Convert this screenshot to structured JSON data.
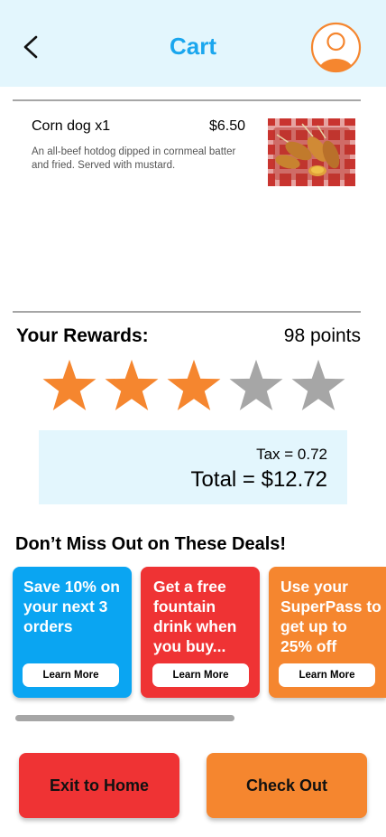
{
  "header": {
    "title": "Cart",
    "back_icon": "chevron-left-icon",
    "avatar_icon": "user-avatar-icon",
    "accent_color": "#1aa6ee",
    "avatar_color": "#f5862f"
  },
  "cart": {
    "items": [
      {
        "name": "Corn dog x1",
        "price": "$6.50",
        "description": "An all-beef hotdog dipped in cornmeal batter and fried. Served with mustard.",
        "image": "corn-dog-photo"
      }
    ]
  },
  "rewards": {
    "label": "Your Rewards:",
    "points": "98 points",
    "stars_filled": 3,
    "stars_total": 5,
    "star_color_filled": "#f5862f",
    "star_color_empty": "#a6a6a6"
  },
  "totals": {
    "tax": "Tax = 0.72",
    "total": "Total = $12.72"
  },
  "deals": {
    "title": "Don’t Miss Out on These Deals!",
    "cards": [
      {
        "text": "Save 10% on your next 3 orders",
        "button": "Learn More",
        "color": "#0aa5f2"
      },
      {
        "text": "Get a free fountain drink when you buy...",
        "button": "Learn More",
        "color": "#ef3334"
      },
      {
        "text": "Use your SuperPass to get up to 25% off",
        "button": "Learn More",
        "color": "#f5862f"
      }
    ],
    "scroll_fraction": 0.57
  },
  "actions": {
    "exit_label": "Exit to Home",
    "exit_color": "#ef3334",
    "checkout_label": "Check Out",
    "checkout_color": "#f5862f"
  }
}
